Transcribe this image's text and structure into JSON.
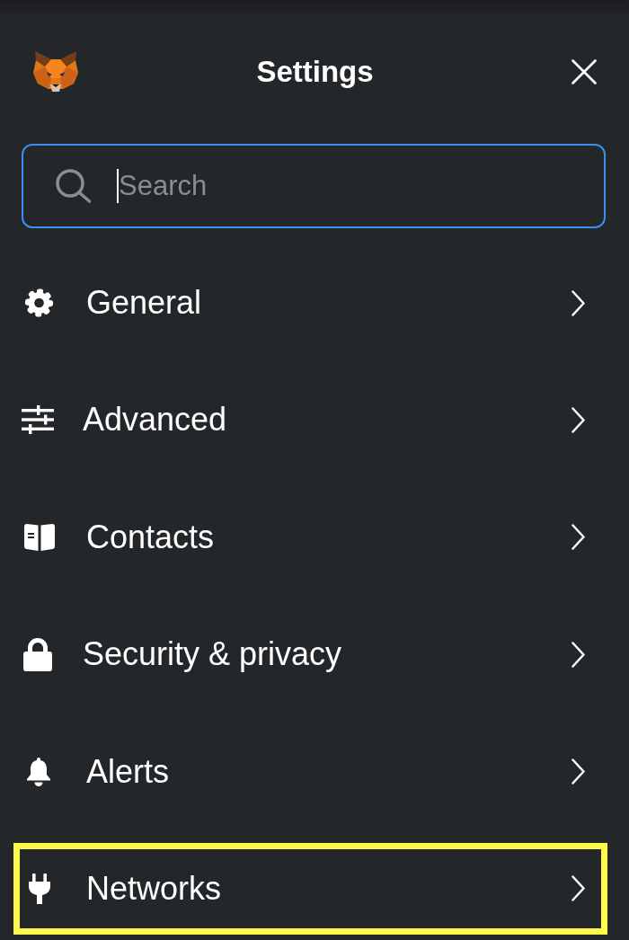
{
  "header": {
    "title": "Settings"
  },
  "search": {
    "placeholder": "Search",
    "focused": true
  },
  "menu": {
    "items": [
      {
        "label": "General",
        "highlighted": false
      },
      {
        "label": "Advanced",
        "highlighted": false
      },
      {
        "label": "Contacts",
        "highlighted": false
      },
      {
        "label": "Security & privacy",
        "highlighted": false
      },
      {
        "label": "Alerts",
        "highlighted": false
      },
      {
        "label": "Networks",
        "highlighted": true
      }
    ]
  }
}
